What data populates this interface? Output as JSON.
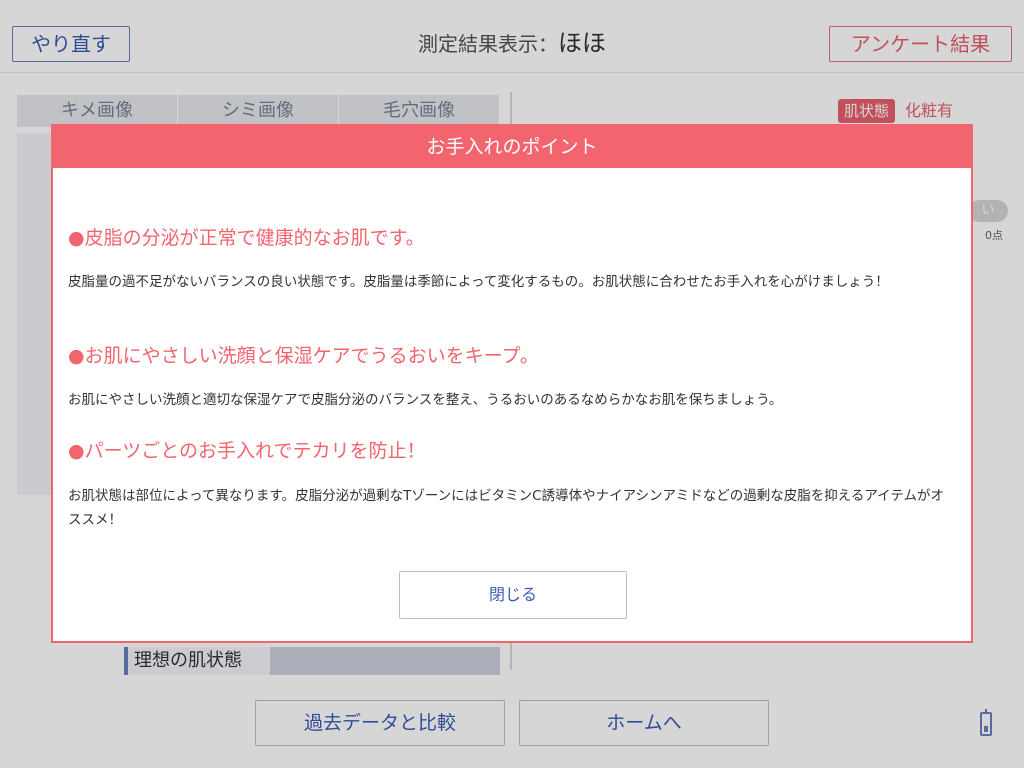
{
  "header": {
    "redo_label": "やり直す",
    "title_prefix": "測定結果表示：",
    "title_value": "ほほ",
    "survey_label": "アンケート結果"
  },
  "tabs": [
    {
      "label": "キメ画像"
    },
    {
      "label": "シミ画像"
    },
    {
      "label": "毛穴画像"
    }
  ],
  "right_panel": {
    "skin_badge": "肌状態",
    "makeup_label": "化粧有",
    "pill_fragment": "い",
    "score_fragment": "0点"
  },
  "ideal_label": "理想の肌状態",
  "bottom": {
    "compare_label": "過去データと比較",
    "home_label": "ホームへ"
  },
  "modal": {
    "title": "お手入れのポイント",
    "points": [
      {
        "title": "●皮脂の分泌が正常で健康的なお肌です。",
        "body": "皮脂量の過不足がないバランスの良い状態です。皮脂量は季節によって変化するもの。お肌状態に合わせたお手入れを心がけましょう！"
      },
      {
        "title": "●お肌にやさしい洗顔と保湿ケアでうるおいをキープ。",
        "body": "お肌にやさしい洗顔と適切な保湿ケアで皮脂分泌のバランスを整え、うるおいのあるなめらかなお肌を保ちましょう。"
      },
      {
        "title": "●パーツごとのお手入れでテカリを防止！",
        "body": "お肌状態は部位によって異なります。皮脂分泌が過剰なTゾーンにはビタミンC誘導体やナイアシンアミドなどの過剰な皮脂を抑えるアイテムがオススメ！"
      }
    ],
    "close_label": "閉じる"
  },
  "colors": {
    "accent_pink": "#f2646e",
    "accent_blue": "#3a5bb5"
  }
}
